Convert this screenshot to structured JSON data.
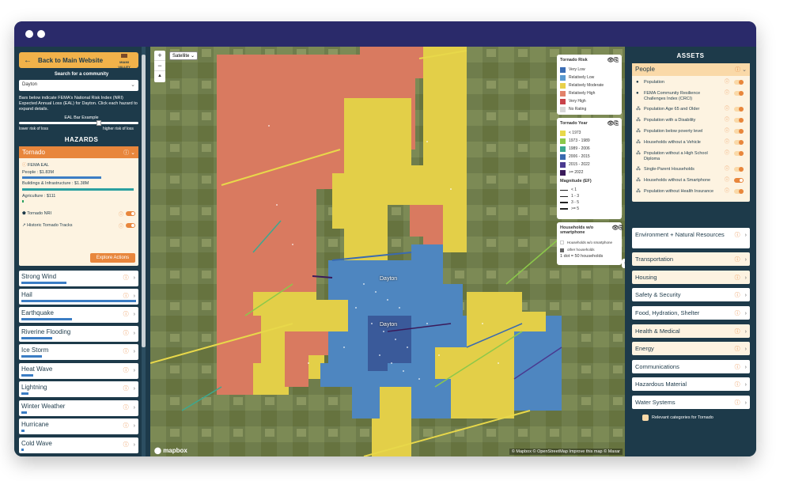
{
  "left": {
    "back_label": "Back to Main Website",
    "logo_text": "MIAMI VALLEY",
    "search_label": "Search for a community",
    "search_value": "Dayton",
    "description": "Bars below indicate FEMA's National Risk Index (NRI) Expected Annual Loss (EAL) for Dayton. Click each hazard to expand details.",
    "eal_example": "EAL Bar Example",
    "eal_low": "lower risk of loss",
    "eal_high": "higher risk of loss",
    "hazards_title": "HAZARDS",
    "tornado": {
      "name": "Tornado",
      "fema_eal": "FEMA EAL",
      "people": "People : $1.83M",
      "buildings": "Buildings & Infrastructure : $1.38M",
      "agriculture": "Agriculture : $111",
      "nri_label": "Tornado NRI",
      "tracks_label": "Historic Tornado Tracks",
      "explore": "Explore Actions"
    },
    "hazards": [
      {
        "name": "Strong Wind",
        "bar": 0.39
      },
      {
        "name": "Hail",
        "bar": 1.0
      },
      {
        "name": "Earthquake",
        "bar": 0.44
      },
      {
        "name": "Riverine Flooding",
        "bar": 0.27
      },
      {
        "name": "Ice Storm",
        "bar": 0.18
      },
      {
        "name": "Heat Wave",
        "bar": 0.1
      },
      {
        "name": "Lightning",
        "bar": 0.06
      },
      {
        "name": "Winter Weather",
        "bar": 0.05
      },
      {
        "name": "Hurricane",
        "bar": 0.03
      },
      {
        "name": "Cold Wave",
        "bar": 0.02
      }
    ]
  },
  "map": {
    "style_select": "Satellite",
    "attribution": "© Mapbox © OpenStreetMap Improve this map © Maxar",
    "mapbox_logo": "mapbox",
    "city_labels": [
      "Dayton",
      "Dayton"
    ],
    "risk_legend": {
      "title": "Tornado Risk",
      "items": [
        {
          "label": "Very Low",
          "color": "#3b6db4"
        },
        {
          "label": "Relatively Low",
          "color": "#5b9ad0"
        },
        {
          "label": "Relatively Moderate",
          "color": "#e8d04a"
        },
        {
          "label": "Relatively High",
          "color": "#e2826a"
        },
        {
          "label": "Very High",
          "color": "#c8424a"
        },
        {
          "label": "No Rating",
          "color": "#d9d9d9"
        }
      ]
    },
    "year_legend": {
      "title": "Tornado Year",
      "items": [
        {
          "label": "< 1973",
          "color": "#e8d84a"
        },
        {
          "label": "1973 - 1989",
          "color": "#8cc84a"
        },
        {
          "label": "1989 - 2006",
          "color": "#3ca890"
        },
        {
          "label": "2006 - 2015",
          "color": "#3a6ab0"
        },
        {
          "label": "2015 - 2022",
          "color": "#4a3a90"
        },
        {
          "label": ">= 2022",
          "color": "#3a1a5a"
        }
      ],
      "magnitude_title": "Magnitude (EF)",
      "magnitudes": [
        "< 1",
        "1 - 3",
        "3 - 5",
        ">= 5"
      ]
    },
    "households_legend": {
      "title": "Households w/o smartphone",
      "item1": "Households w/o smartphone",
      "item2": "other households",
      "note": "1 dot = 50 households"
    }
  },
  "right": {
    "assets_title": "ASSETS",
    "people_title": "People",
    "people_items": [
      {
        "icon": "●",
        "label": "Population",
        "on": false
      },
      {
        "icon": "●",
        "label": "FEMA Community Resilience Challenges Index (CRCI)",
        "on": false
      },
      {
        "icon": "⁂",
        "label": "Population Age 65 and Older",
        "on": false
      },
      {
        "icon": "⁂",
        "label": "Population with a Disability",
        "on": false
      },
      {
        "icon": "⁂",
        "label": "Population below poverty level",
        "on": false
      },
      {
        "icon": "⁂",
        "label": "Households without a Vehicle",
        "on": false
      },
      {
        "icon": "⁂",
        "label": "Population without a High School Diploma",
        "on": false
      },
      {
        "icon": "⁂",
        "label": "Single-Parent Households",
        "on": false
      },
      {
        "icon": "⁂",
        "label": "Households without a Smartphone",
        "on": true
      },
      {
        "icon": "⁂",
        "label": "Population without Health Insurance",
        "on": false
      }
    ],
    "categories": [
      {
        "label": "Environment + Natural Resources",
        "highlight": false
      },
      {
        "label": "Transportation",
        "highlight": true
      },
      {
        "label": "Housing",
        "highlight": true
      },
      {
        "label": "Safety & Security",
        "highlight": false
      },
      {
        "label": "Food, Hydration, Shelter",
        "highlight": false
      },
      {
        "label": "Health & Medical",
        "highlight": true
      },
      {
        "label": "Energy",
        "highlight": true
      },
      {
        "label": "Communications",
        "highlight": false
      },
      {
        "label": "Hazardous Material",
        "highlight": false
      },
      {
        "label": "Water Systems",
        "highlight": false
      }
    ],
    "relevant_label": "Relevant categories for Tornado"
  }
}
